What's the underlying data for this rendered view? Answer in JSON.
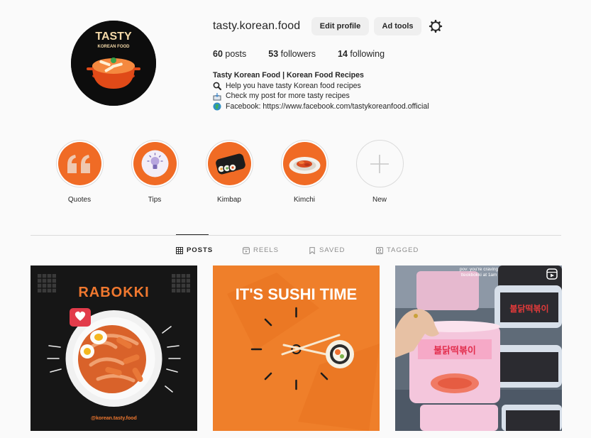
{
  "profile": {
    "username": "tasty.korean.food",
    "edit_profile_label": "Edit profile",
    "ad_tools_label": "Ad tools",
    "avatar_text_top": "TASTY",
    "avatar_text_bottom": "KOREAN FOOD"
  },
  "stats": {
    "posts_count": "60",
    "posts_label": "posts",
    "followers_count": "53",
    "followers_label": "followers",
    "following_count": "14",
    "following_label": "following"
  },
  "bio": {
    "name": "Tasty Korean Food | Korean Food Recipes",
    "lines": [
      {
        "icon": "magnifier-icon",
        "text": "Help you have tasty Korean food recipes"
      },
      {
        "icon": "inbox-tray-icon",
        "text": "Check my post for more tasty recipes"
      },
      {
        "icon": "globe-icon",
        "text": "Facebook: https://www.facebook.com/tastykoreanfood.official"
      }
    ]
  },
  "highlights": [
    {
      "label": "Quotes",
      "icon": "quote-icon"
    },
    {
      "label": "Tips",
      "icon": "lightbulb-icon"
    },
    {
      "label": "Kimbap",
      "icon": "kimbap-icon"
    },
    {
      "label": "Kimchi",
      "icon": "kimchi-icon"
    },
    {
      "label": "New",
      "icon": "plus-icon"
    }
  ],
  "tabs": [
    {
      "label": "POSTS",
      "icon": "grid-icon",
      "active": true
    },
    {
      "label": "REELS",
      "icon": "reels-icon",
      "active": false
    },
    {
      "label": "SAVED",
      "icon": "bookmark-icon",
      "active": false
    },
    {
      "label": "TAGGED",
      "icon": "tagged-icon",
      "active": false
    }
  ],
  "posts": [
    {
      "title": "RABOKKI",
      "handle": "@korean.tasty.food"
    },
    {
      "title": "IT'S SUSHI TIME"
    },
    {
      "caption_line1": "pov: you're craving",
      "caption_line2": "tteokbokki at 1am",
      "package_text": "불닭떡볶이"
    }
  ],
  "colors": {
    "accent_orange": "#f06b25",
    "background": "#fafafa",
    "button_bg": "#efefef",
    "text": "#262626",
    "muted": "#8e8e8e"
  }
}
